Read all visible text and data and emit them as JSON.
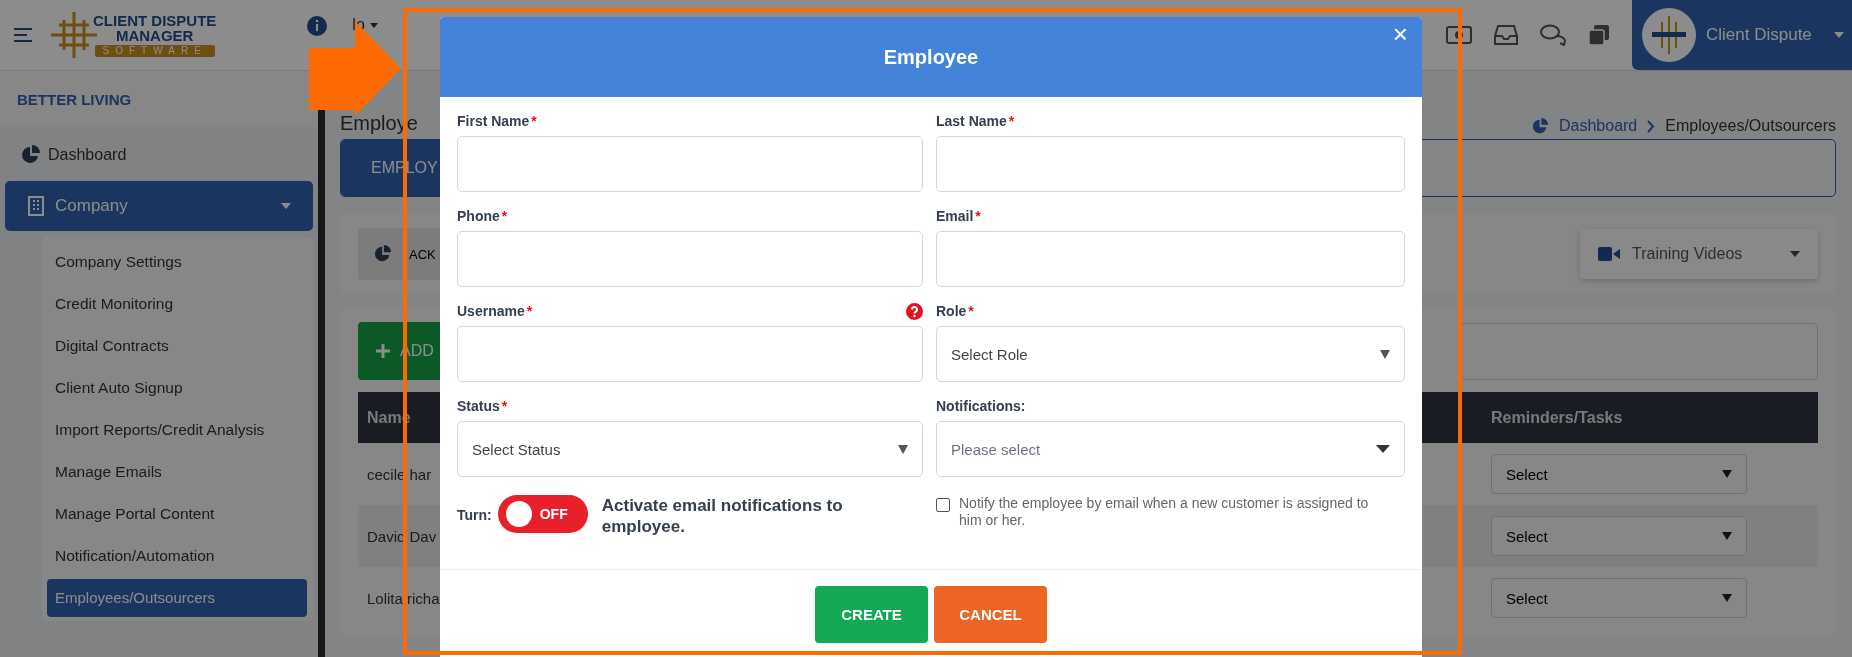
{
  "header": {
    "logo_lines": [
      "CLIENT DISPUTE",
      "MANAGER",
      "SOFTWARE"
    ],
    "menu_fragment": "lo",
    "user_name": "Client Dispute"
  },
  "sidebar": {
    "account": "BETTER LIVING",
    "items": [
      {
        "label": "Dashboard",
        "kind": "link"
      },
      {
        "label": "Company",
        "kind": "group",
        "expanded": true,
        "children": [
          {
            "label": "Company Settings",
            "selected": false
          },
          {
            "label": "Credit Monitoring",
            "selected": false
          },
          {
            "label": "Digital Contracts",
            "selected": false
          },
          {
            "label": "Client Auto Signup",
            "selected": false
          },
          {
            "label": "Import Reports/Credit Analysis",
            "selected": false
          },
          {
            "label": "Manage Emails",
            "selected": false
          },
          {
            "label": "Manage Portal Content",
            "selected": false
          },
          {
            "label": "Notification/Automation",
            "selected": false
          },
          {
            "label": "Employees/Outsourcers",
            "selected": true
          }
        ]
      }
    ]
  },
  "page": {
    "title": "Employe",
    "breadcrumb": [
      "Dashboard",
      "Employees/Outsourcers"
    ],
    "tab": "EMPLOY",
    "back": "ACK",
    "training_videos": "Training Videos",
    "add": "ADD",
    "table": {
      "columns": [
        "Name",
        "Reminders/Tasks"
      ],
      "rows": [
        {
          "name": "cecile har",
          "reminder": "Select"
        },
        {
          "name": "David Dav",
          "reminder": "Select"
        },
        {
          "name": "Lolita richa",
          "reminder": "Select"
        }
      ]
    }
  },
  "dialog": {
    "title": "Employee",
    "close": "×",
    "fields": [
      {
        "label": "First Name",
        "mark": "*",
        "kind": "text"
      },
      {
        "label": "Last Name",
        "mark": "*",
        "kind": "text"
      },
      {
        "label": "Phone",
        "mark": "*",
        "kind": "text"
      },
      {
        "label": "Email",
        "mark": "*",
        "kind": "text"
      },
      {
        "label": "Username",
        "mark": "*",
        "kind": "text",
        "help": true
      },
      {
        "label": "Role",
        "mark": "*",
        "kind": "select",
        "placeholder": "Select Role"
      },
      {
        "label": "Status",
        "mark": "*",
        "kind": "select",
        "placeholder": "Select Status"
      },
      {
        "label": "Notifications:",
        "kind": "multiselect",
        "placeholder": "Please select"
      }
    ],
    "toggle": {
      "label": "Turn:",
      "on": false,
      "text": "OFF",
      "description": "Activate email notifications to employee."
    },
    "notify": {
      "checked": false,
      "label": "Notify the employee by email when a new customer is assigned to him or her."
    },
    "buttons": [
      {
        "label": "CREATE",
        "kind": "primary"
      },
      {
        "label": "CANCEL",
        "kind": "cancel"
      }
    ]
  }
}
